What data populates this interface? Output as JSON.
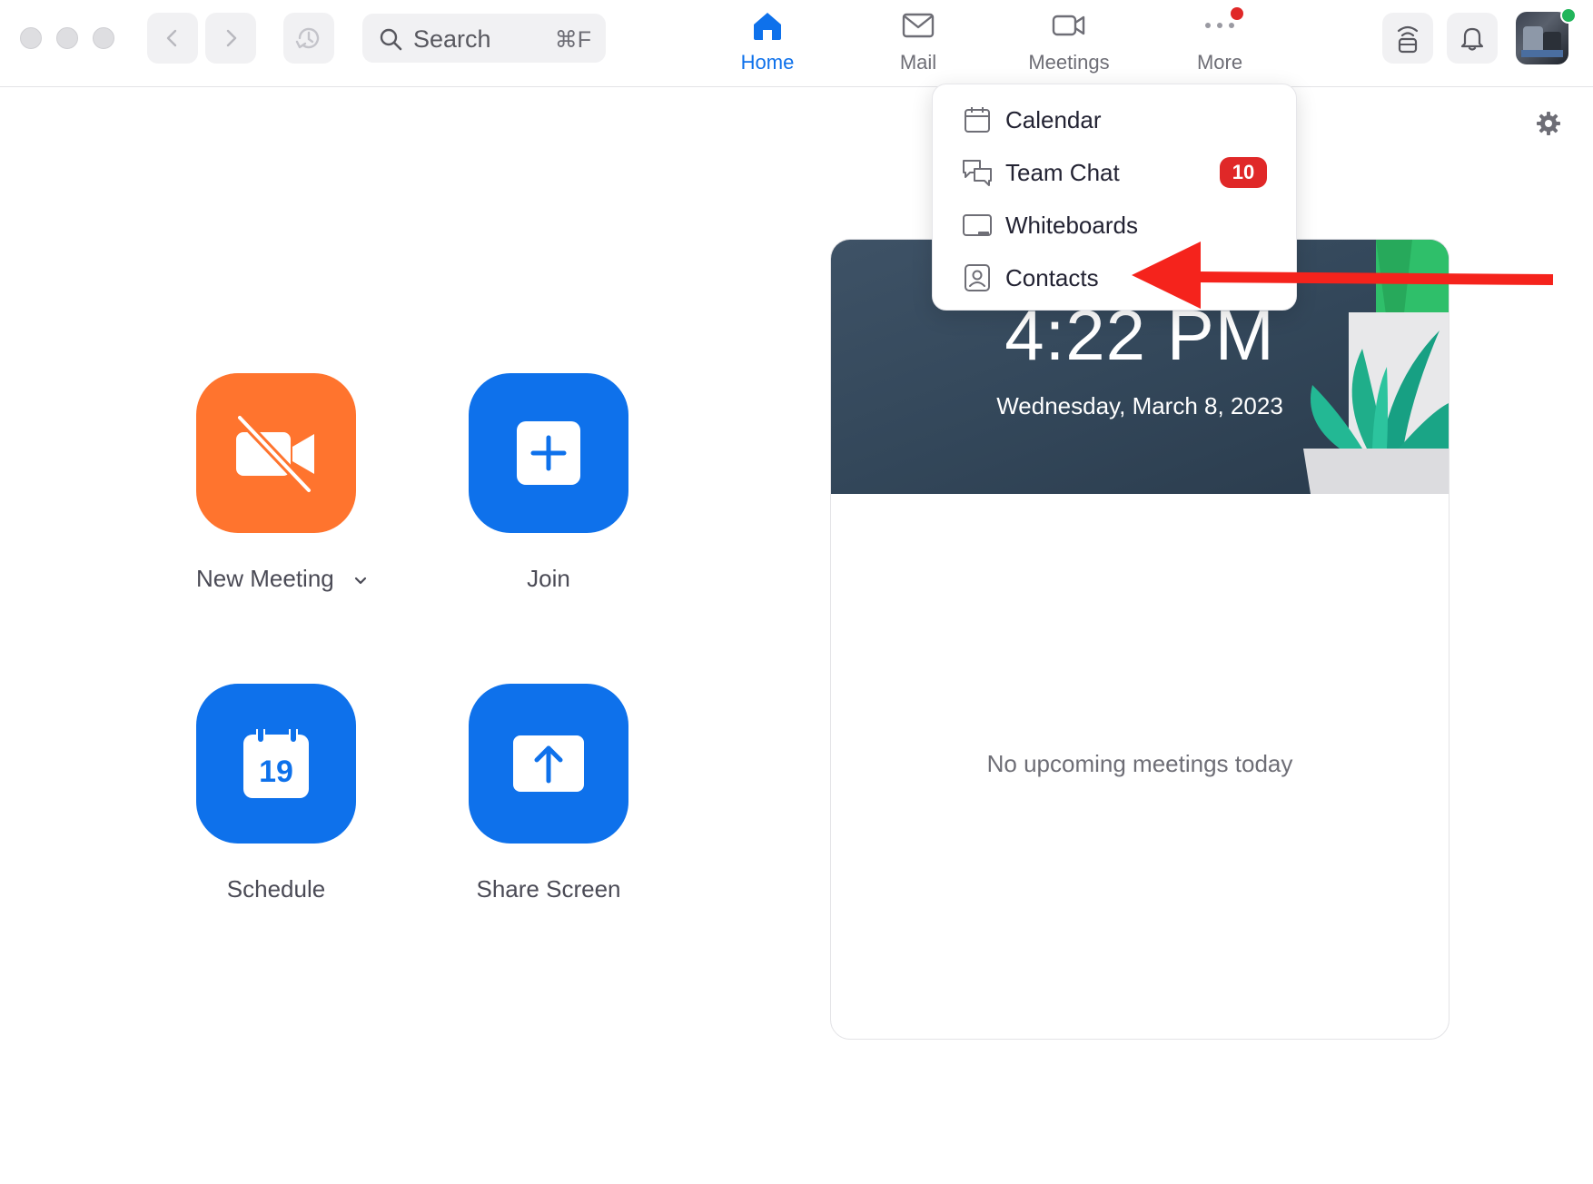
{
  "search": {
    "label": "Search",
    "shortcut": "⌘F"
  },
  "tabs": [
    {
      "label": "Home",
      "icon": "home-icon",
      "active": true
    },
    {
      "label": "Mail",
      "icon": "mail-icon"
    },
    {
      "label": "Meetings",
      "icon": "video-camera-icon"
    },
    {
      "label": "More",
      "icon": "more-dots-icon"
    }
  ],
  "actions": {
    "new_meeting": "New Meeting",
    "join": "Join",
    "schedule": "Schedule",
    "schedule_day": "19",
    "share_screen": "Share Screen"
  },
  "card": {
    "time": "4:22 PM",
    "date": "Wednesday, March 8, 2023",
    "empty_message": "No upcoming meetings today"
  },
  "more_menu": {
    "items": [
      {
        "label": "Calendar",
        "icon": "calendar-icon"
      },
      {
        "label": "Team Chat",
        "icon": "chat-icon",
        "badge": "10"
      },
      {
        "label": "Whiteboards",
        "icon": "whiteboard-icon"
      },
      {
        "label": "Contacts",
        "icon": "contacts-icon"
      }
    ]
  },
  "colors": {
    "accent": "#0e71eb",
    "orange": "#ff742e",
    "badge": "#e02828",
    "annotation_arrow": "#f5231c"
  }
}
